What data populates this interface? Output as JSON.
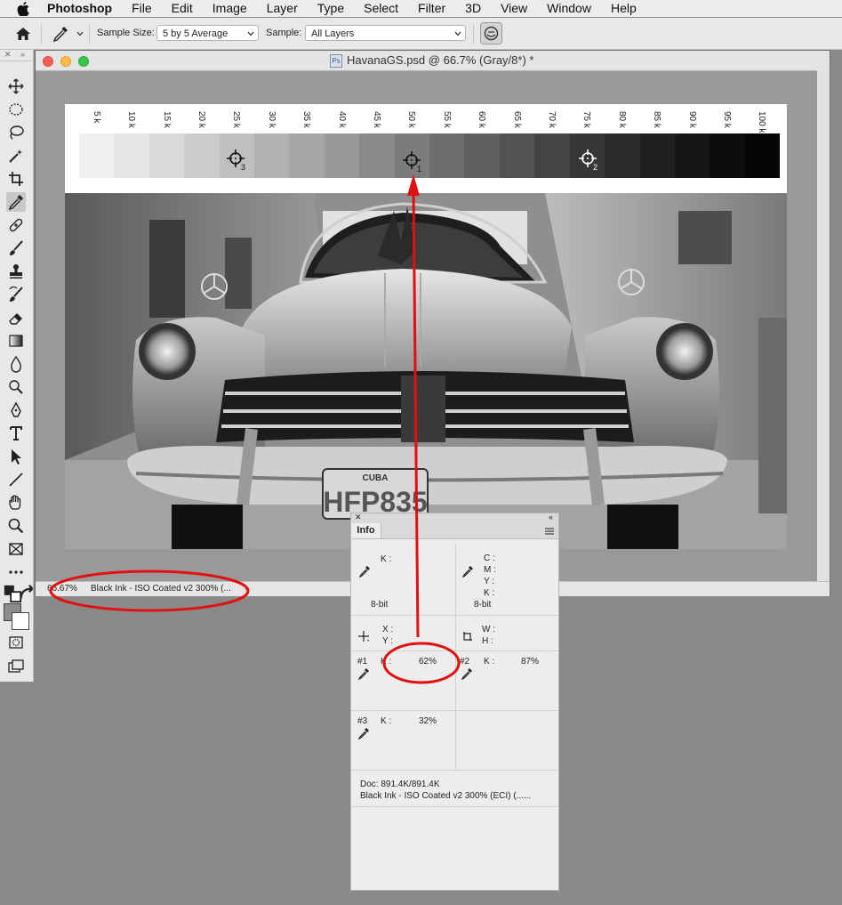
{
  "menubar": {
    "app": "Photoshop",
    "items": [
      "File",
      "Edit",
      "Image",
      "Layer",
      "Type",
      "Select",
      "Filter",
      "3D",
      "View",
      "Window",
      "Help"
    ]
  },
  "options": {
    "sample_size_label": "Sample Size:",
    "sample_size_value": "5 by 5 Average",
    "sample_label": "Sample:",
    "sample_value": "All Layers"
  },
  "document": {
    "title": "HavanaGS.psd @ 66.7% (Gray/8*) *",
    "zoom": "66.67%",
    "profile": "Black Ink - ISO Coated v2 300% (..."
  },
  "scale": {
    "labels": [
      "5 k",
      "10 k",
      "15 k",
      "20 k",
      "25 k",
      "30 k",
      "35 k",
      "40 k",
      "45 k",
      "50 k",
      "55 k",
      "60 k",
      "65 k",
      "70 k",
      "75 k",
      "80 k",
      "85 k",
      "90 k",
      "95 k",
      "100 k"
    ],
    "grays": [
      "#f0f0f0",
      "#e5e5e5",
      "#d9d9d9",
      "#cccccc",
      "#bfbfbf",
      "#b2b2b2",
      "#a5a5a5",
      "#989898",
      "#8a8a8a",
      "#7c7c7c",
      "#6e6e6e",
      "#606060",
      "#525252",
      "#444444",
      "#373737",
      "#2b2b2b",
      "#202020",
      "#161616",
      "#0d0d0d",
      "#050505"
    ]
  },
  "samplers": [
    {
      "num": "3"
    },
    {
      "num": "1"
    },
    {
      "num": "2"
    }
  ],
  "plate": {
    "line1": "CUBA",
    "line2": "HFP835"
  },
  "info": {
    "tab": "Info",
    "k_label": "K :",
    "cmyk": [
      "C :",
      "M :",
      "Y :",
      "K :"
    ],
    "bit_left": "8-bit",
    "bit_right": "8-bit",
    "x_label": "X :",
    "y_label": "Y :",
    "w_label": "W :",
    "h_label": "H :",
    "s1_name": "#1",
    "s1_k": "K :",
    "s1_val": "62%",
    "s2_name": "#2",
    "s2_k": "K :",
    "s2_val": "87%",
    "s3_name": "#3",
    "s3_k": "K :",
    "s3_val": "32%",
    "doc": "Doc: 891.4K/891.4K",
    "profile": "Black Ink - ISO Coated v2 300% (ECI) (......"
  },
  "colors": {
    "annotation": "#e01010",
    "fg": "#8b8b8b",
    "bg": "#ffffff"
  }
}
